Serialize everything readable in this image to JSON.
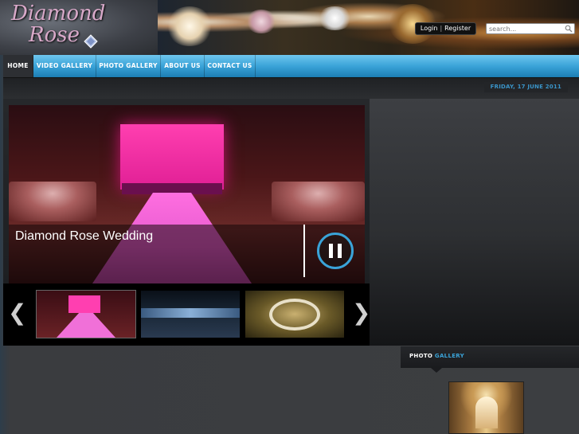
{
  "header": {
    "logo_line1": "Diamond",
    "logo_line2": "Rose",
    "login_label": "Login",
    "register_label": "Register",
    "search_placeholder": "search..."
  },
  "nav": {
    "items": [
      {
        "label": "HOME",
        "active": true
      },
      {
        "label": "VIDEO GALLERY",
        "active": false
      },
      {
        "label": "PHOTO GALLERY",
        "active": false
      },
      {
        "label": "ABOUT US",
        "active": false
      },
      {
        "label": "CONTACT US",
        "active": false
      }
    ]
  },
  "date": "FRIDAY, 17 JUNE 2011",
  "slider": {
    "caption": "Diamond Rose Wedding",
    "prev_icon": "chevron-left-icon",
    "next_icon": "chevron-right-icon",
    "pause_icon": "pause-icon",
    "prev_glyph": "❮",
    "next_glyph": "❯"
  },
  "gallery": {
    "title_part1": "PHOTO",
    "title_part2": "GALLERY"
  },
  "colors": {
    "accent": "#3aa3d8",
    "nav_blue": "#2a8fc8",
    "background": "#3c3e41",
    "highlight_pink": "#e01f95"
  }
}
